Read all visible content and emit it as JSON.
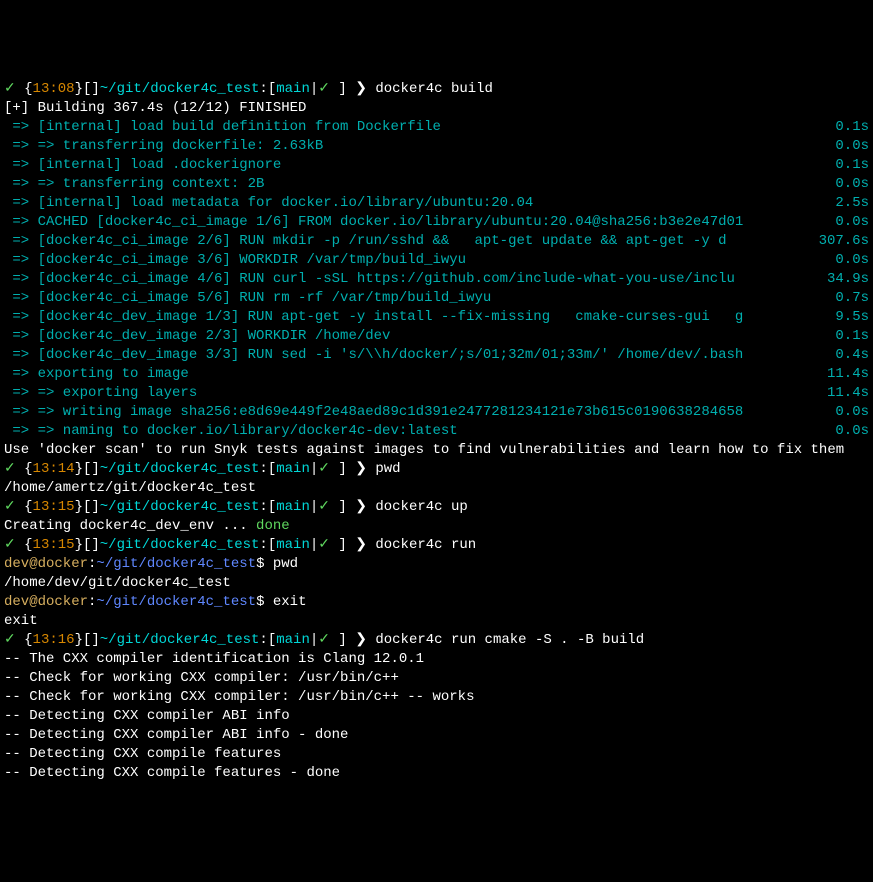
{
  "prompts": [
    {
      "check": "✓",
      "time": "13:08",
      "path": "~/git/docker4c_test",
      "branch": "main",
      "cmd": "docker4c build"
    },
    {
      "check": "✓",
      "time": "13:14",
      "path": "~/git/docker4c_test",
      "branch": "main",
      "cmd": "pwd"
    },
    {
      "check": "✓",
      "time": "13:15",
      "path": "~/git/docker4c_test",
      "branch": "main",
      "cmd": "docker4c up"
    },
    {
      "check": "✓",
      "time": "13:15",
      "path": "~/git/docker4c_test",
      "branch": "main",
      "cmd": "docker4c run"
    },
    {
      "check": "✓",
      "time": "13:16",
      "path": "~/git/docker4c_test",
      "branch": "main",
      "cmd": "docker4c run cmake -S . -B build"
    }
  ],
  "build_header": "[+] Building 367.4s (12/12) FINISHED",
  "build_steps": [
    {
      "text": "[internal] load build definition from Dockerfile",
      "time": "0.1s",
      "sub": false
    },
    {
      "text": "=> transferring dockerfile: 2.63kB",
      "time": "0.0s",
      "sub": true
    },
    {
      "text": "[internal] load .dockerignore",
      "time": "0.1s",
      "sub": false
    },
    {
      "text": "=> transferring context: 2B",
      "time": "0.0s",
      "sub": true
    },
    {
      "text": "[internal] load metadata for docker.io/library/ubuntu:20.04",
      "time": "2.5s",
      "sub": false
    },
    {
      "text": "CACHED [docker4c_ci_image 1/6] FROM docker.io/library/ubuntu:20.04@sha256:b3e2e47d01",
      "time": "0.0s",
      "sub": false
    },
    {
      "text": "[docker4c_ci_image 2/6] RUN mkdir -p /run/sshd &&   apt-get update && apt-get -y d",
      "time": "307.6s",
      "sub": false
    },
    {
      "text": "[docker4c_ci_image 3/6] WORKDIR /var/tmp/build_iwyu",
      "time": "0.0s",
      "sub": false
    },
    {
      "text": "[docker4c_ci_image 4/6] RUN curl -sSL https://github.com/include-what-you-use/inclu",
      "time": "34.9s",
      "sub": false
    },
    {
      "text": "[docker4c_ci_image 5/6] RUN rm -rf /var/tmp/build_iwyu",
      "time": "0.7s",
      "sub": false
    },
    {
      "text": "[docker4c_dev_image 1/3] RUN apt-get -y install --fix-missing   cmake-curses-gui   g",
      "time": "9.5s",
      "sub": false
    },
    {
      "text": "[docker4c_dev_image 2/3] WORKDIR /home/dev",
      "time": "0.1s",
      "sub": false
    },
    {
      "text": "[docker4c_dev_image 3/3] RUN sed -i 's/\\\\h/docker/;s/01;32m/01;33m/' /home/dev/.bash",
      "time": "0.4s",
      "sub": false
    },
    {
      "text": "exporting to image",
      "time": "11.4s",
      "sub": false
    },
    {
      "text": "=> exporting layers",
      "time": "11.4s",
      "sub": true
    },
    {
      "text": "=> writing image sha256:e8d69e449f2e48aed89c1d391e2477281234121e73b615c0190638284658",
      "time": "0.0s",
      "sub": true
    },
    {
      "text": "=> naming to docker.io/library/docker4c-dev:latest",
      "time": "0.0s",
      "sub": true
    }
  ],
  "scan_msg": "Use 'docker scan' to run Snyk tests against images to find vulnerabilities and learn how to fix them",
  "pwd_out1": "/home/amertz/git/docker4c_test",
  "creating_line": {
    "prefix": "Creating docker4c_dev_env ... ",
    "done": "done"
  },
  "docker_prompts": [
    {
      "user": "dev@docker",
      "path": "~/git/docker4c_test",
      "cmd": "pwd"
    },
    {
      "user": "dev@docker",
      "path": "~/git/docker4c_test",
      "cmd": "exit"
    }
  ],
  "pwd_out2": "/home/dev/git/docker4c_test",
  "exit_echo": "exit",
  "cmake_lines": [
    "-- The CXX compiler identification is Clang 12.0.1",
    "-- Check for working CXX compiler: /usr/bin/c++",
    "-- Check for working CXX compiler: /usr/bin/c++ -- works",
    "-- Detecting CXX compiler ABI info",
    "-- Detecting CXX compiler ABI info - done",
    "-- Detecting CXX compile features",
    "-- Detecting CXX compile features - done"
  ],
  "glyphs": {
    "arrow": "❯",
    "check_icon": "✓",
    "sep": "|"
  }
}
